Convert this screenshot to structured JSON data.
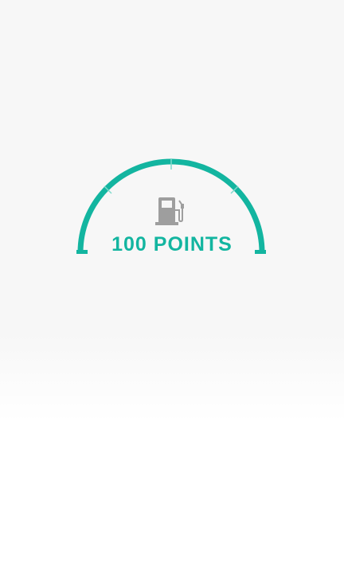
{
  "gauge": {
    "points_text": "100 POINTS",
    "icon": "fuel-pump-icon",
    "accent_color": "#13b5a0",
    "icon_color": "#9e9e9e",
    "tick_color": "#7fd9cc"
  }
}
